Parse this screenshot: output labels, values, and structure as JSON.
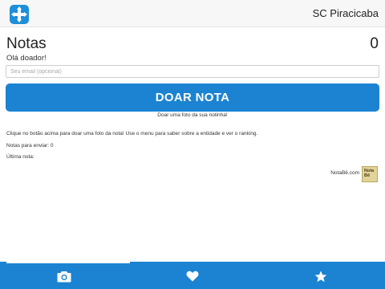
{
  "header": {
    "place_name": "SC Piracicaba",
    "logo_icon": "cross-arrows-icon",
    "logo_color": "#1e8fd8"
  },
  "main": {
    "title": "Notas",
    "count": "0",
    "greeting": "Olá doador!",
    "email_placeholder": "Seu email (opcional)",
    "email_value": "",
    "donate_label": "DOAR NOTA",
    "donate_caption": "Doar uma foto da sua notinha!",
    "instructions": "Clique no botão acima para doar uma foto da nota! Use o menu para saber sobre a entidade e ver o ranking.",
    "pending_text": "Notas para enviar: 0",
    "last_note_label": "Última nota:",
    "brand_link": "NotaBê.com",
    "brand_logo_text": "Nota Bê",
    "accent_color": "#1b83d2"
  },
  "tabbar": {
    "active_tab": "camera",
    "tabs": [
      {
        "name": "camera",
        "icon": "camera-icon"
      },
      {
        "name": "favorites",
        "icon": "heart-icon"
      },
      {
        "name": "ranking",
        "icon": "star-icon"
      }
    ]
  }
}
